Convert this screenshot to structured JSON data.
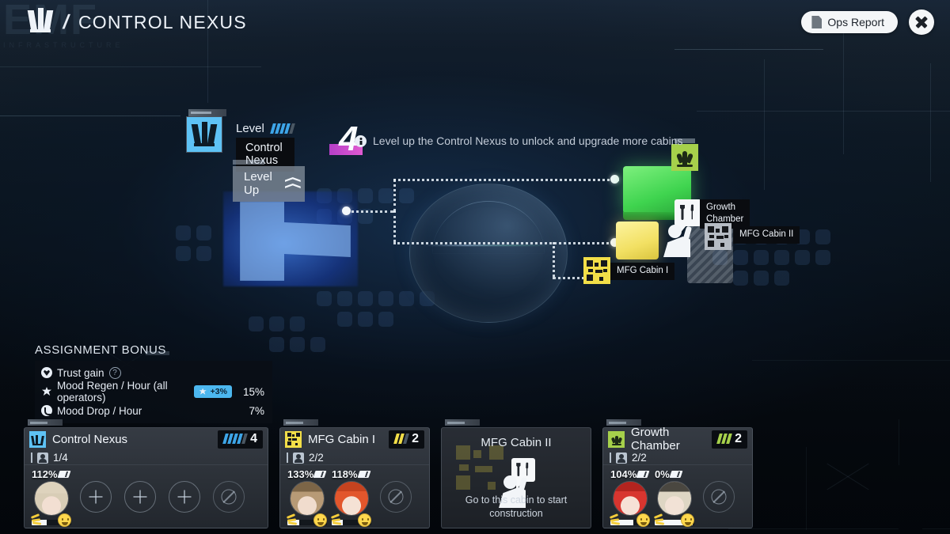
{
  "header": {
    "watermark": "EMF",
    "watermark_sub": "INFRASTRUCTURE",
    "logo_icon": "control-nexus-icon",
    "separator": "/",
    "title": "CONTROL NEXUS",
    "ops_report_label": "Ops Report",
    "ops_report_icon": "document-icon",
    "close_icon": "close-icon"
  },
  "level_panel": {
    "icon": "control-nexus-icon",
    "level_word": "Level",
    "pips_total": 5,
    "pips_filled": 4,
    "facility_name": "Control Nexus",
    "level_value": "4",
    "level_up_label": "Level Up",
    "level_up_icon": "double-chevron-up-icon",
    "hint_icon": "info-icon",
    "hint_text": "Level up the Control Nexus to unlock and upgrade more cabins"
  },
  "map": {
    "nodes": [
      {
        "id": "growth-chamber",
        "label": "Growth\nChamber",
        "icon": "leaf-icon",
        "color": "#a6d04b"
      },
      {
        "id": "mfg-cabin-1",
        "label": "MFG Cabin I",
        "icon": "mfg-icon",
        "color": "#f2de48"
      },
      {
        "id": "mfg-cabin-2",
        "label": "MFG Cabin II",
        "icon": "mfg-icon",
        "color": "#b6bcc4"
      }
    ],
    "construction_icon": "wrench-screwdriver-icon",
    "worker_icon": "worker-icon"
  },
  "assignment_bonus": {
    "title": "ASSIGNMENT BONUS",
    "rows": [
      {
        "icon": "trust-icon",
        "name": "Trust gain",
        "help": "?",
        "buff": "",
        "value": ""
      },
      {
        "icon": "mood-up-icon",
        "name": "Mood Regen / Hour (all operators)",
        "help": "",
        "buff": "+3%",
        "value": "15%"
      },
      {
        "icon": "mood-down-icon",
        "name": "Mood Drop / Hour",
        "help": "",
        "buff": "",
        "value": "7%"
      }
    ],
    "buff_color": "#4cb7ef"
  },
  "cards": [
    {
      "id": "control-nexus",
      "name": "Control Nexus",
      "icon": "control-nexus-icon",
      "icon_color": "#5ec2f5",
      "pips_total": 5,
      "pips_filled": 4,
      "pip_color": "#3da5e8",
      "level": "4",
      "occupancy": "1/4",
      "type": "staffed",
      "slots": [
        {
          "kind": "operator",
          "pct": "112%",
          "mood": 0.38,
          "hair": "#d8cdb6",
          "skin": "#f2dfd2"
        },
        {
          "kind": "empty"
        },
        {
          "kind": "empty"
        },
        {
          "kind": "empty"
        },
        {
          "kind": "locked"
        }
      ]
    },
    {
      "id": "mfg-cabin-1",
      "name": "MFG Cabin I",
      "icon": "mfg-icon",
      "icon_color": "#f2de48",
      "pips_total": 3,
      "pips_filled": 2,
      "pip_color": "#f2de48",
      "level": "2",
      "occupancy": "2/2",
      "type": "staffed",
      "slots": [
        {
          "kind": "operator",
          "pct": "133%",
          "mood": 0.3,
          "hair": "#b79a76",
          "skin": "#f0dccd"
        },
        {
          "kind": "operator",
          "pct": "118%",
          "mood": 0.28,
          "hair": "#e2562c",
          "skin": "#f5e2d5"
        },
        {
          "kind": "locked"
        }
      ]
    },
    {
      "id": "mfg-cabin-2",
      "name": "MFG Cabin II",
      "icon": "mfg-icon",
      "icon_color": "#c9b93f",
      "level": "",
      "occupancy": "",
      "type": "construction",
      "message": "Go to this cabin to start construction",
      "worker_icon": "worker-icon",
      "tool_icon": "wrench-screwdriver-icon"
    },
    {
      "id": "growth-chamber",
      "name": "Growth Chamber",
      "icon": "leaf-icon",
      "icon_color": "#a6d04b",
      "pips_total": 3,
      "pips_filled": 3,
      "pip_color": "#a6d04b",
      "level": "2",
      "occupancy": "2/2",
      "type": "staffed",
      "slots": [
        {
          "kind": "operator",
          "pct": "104%",
          "mood": 0.58,
          "hair": "#d8352f",
          "skin": "#f6e1d6"
        },
        {
          "kind": "operator",
          "pct": "0%",
          "mood": 0.96,
          "hair": "#ded6c4",
          "skin": "#f2e2d6"
        },
        {
          "kind": "locked"
        }
      ]
    }
  ]
}
